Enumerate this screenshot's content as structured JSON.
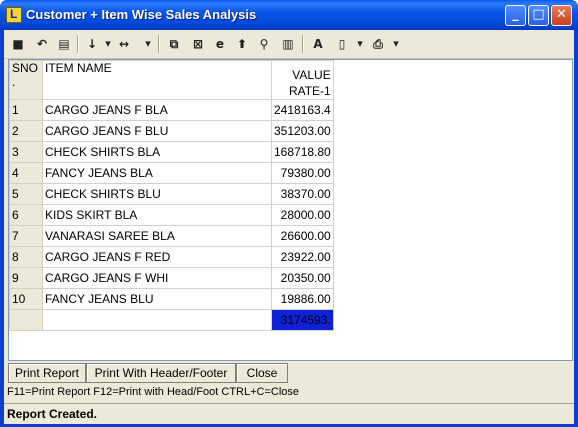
{
  "window": {
    "title": "Customer + Item Wise Sales Analysis"
  },
  "toolbar": {
    "tools": [
      "save-icon",
      "undo-icon",
      "print-preview-icon",
      "sort-icon",
      "column-width-icon",
      "copy-icon",
      "excel-icon",
      "browser-icon",
      "arrow-up-icon",
      "find-icon",
      "chart-icon",
      "font-icon",
      "page-setup-icon",
      "printer-icon"
    ]
  },
  "grid": {
    "columns": {
      "sno": "SNO\n.",
      "item_name": "ITEM NAME",
      "value": "VALUE\nRATE-1"
    },
    "rows": [
      {
        "sno": "1",
        "item": "CARGO JEANS F BLA",
        "value": "2418163.4"
      },
      {
        "sno": "2",
        "item": "CARGO JEANS F BLU",
        "value": "351203.00"
      },
      {
        "sno": "3",
        "item": "CHECK SHIRTS BLA",
        "value": "168718.80"
      },
      {
        "sno": "4",
        "item": "FANCY JEANS BLA",
        "value": "79380.00"
      },
      {
        "sno": "5",
        "item": "CHECK SHIRTS BLU",
        "value": "38370.00"
      },
      {
        "sno": "6",
        "item": "KIDS SKIRT BLA",
        "value": "28000.00"
      },
      {
        "sno": "7",
        "item": "VANARASI SAREE BLA",
        "value": "26600.00"
      },
      {
        "sno": "8",
        "item": "CARGO JEANS F RED",
        "value": "23922.00"
      },
      {
        "sno": "9",
        "item": "CARGO JEANS F WHI",
        "value": "20350.00"
      },
      {
        "sno": "10",
        "item": "FANCY JEANS BLU",
        "value": "19886.00"
      }
    ],
    "total": "3174593."
  },
  "buttons": {
    "print_report": "Print Report",
    "print_header_footer": "Print With Header/Footer",
    "close": "Close"
  },
  "hint": "F11=Print Report  F12=Print with Head/Foot  CTRL+C=Close",
  "status": "Report Created.",
  "colors": {
    "titlebar": "#0047d8",
    "total_bg": "#1020d8",
    "total_text": "#ffe14a"
  }
}
